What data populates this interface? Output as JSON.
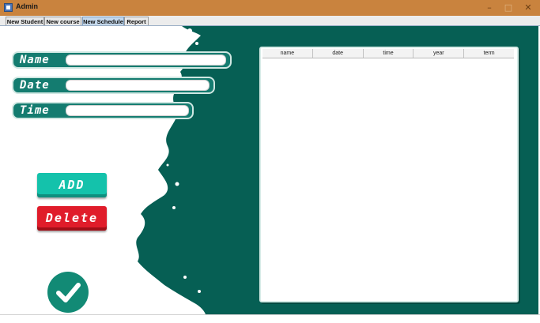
{
  "window": {
    "title": "Admin",
    "controls": {
      "minimize": "–",
      "maximize": "□",
      "close": "✕"
    }
  },
  "tabs": [
    {
      "label": "New Student",
      "active": false
    },
    {
      "label": "New course",
      "active": false
    },
    {
      "label": "New Schedule",
      "active": true
    },
    {
      "label": "Report",
      "active": false
    }
  ],
  "form": {
    "name": {
      "label": "Name",
      "value": ""
    },
    "date": {
      "label": "Date",
      "value": ""
    },
    "time": {
      "label": "Time",
      "value": ""
    }
  },
  "buttons": {
    "add": "ADD",
    "delete": "Delete"
  },
  "table": {
    "columns": [
      "name",
      "date",
      "time",
      "year",
      "term"
    ],
    "rows": []
  },
  "icons": {
    "app": "app-window-icon",
    "confirm": "check-circle-icon"
  },
  "colors": {
    "background_teal": "#065f54",
    "add_button": "#14c2ab",
    "delete_button": "#e01c2a",
    "title_bar": "#c9833e"
  }
}
